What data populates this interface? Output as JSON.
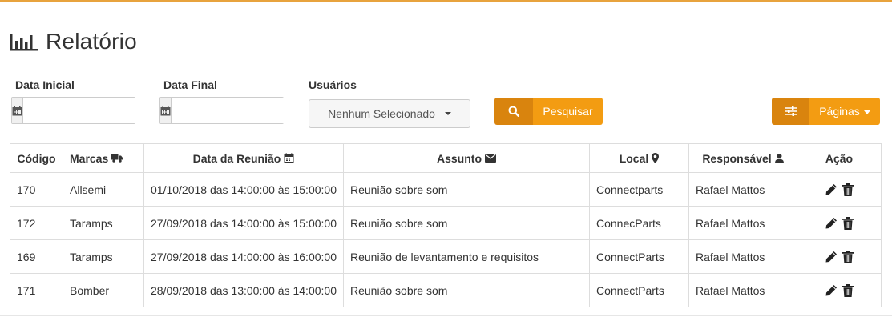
{
  "page": {
    "title": "Relatório",
    "title_icon": "bar-chart-icon"
  },
  "filters": {
    "data_inicial": {
      "label": "Data Inicial",
      "value": "",
      "icon": "calendar-icon"
    },
    "data_final": {
      "label": "Data Final",
      "value": "",
      "icon": "calendar-icon"
    },
    "usuarios": {
      "label": "Usuários",
      "selected": "Nenhum Selecionado"
    },
    "search_button": {
      "label": "Pesquisar",
      "icon": "search-icon"
    },
    "pages_button": {
      "label": "Páginas",
      "icon": "sliders-icon"
    }
  },
  "colors": {
    "accent": "#f39c12",
    "accent_dark": "#d9840e",
    "top_border": "#e8a33d"
  },
  "table": {
    "headers": {
      "codigo": "Código",
      "marcas": "Marcas",
      "data": "Data da Reunião",
      "assunto": "Assunto",
      "local": "Local",
      "responsavel": "Responsável",
      "acao": "Ação"
    },
    "header_icons": {
      "marcas": "truck-icon",
      "data": "calendar-icon",
      "assunto": "envelope-icon",
      "local": "map-marker-icon",
      "responsavel": "user-icon"
    },
    "rows": [
      {
        "codigo": "170",
        "marca": "Allsemi",
        "data": "01/10/2018 das 14:00:00 às 15:00:00",
        "assunto": "Reunião sobre som",
        "local": "Connectparts",
        "responsavel": "Rafael Mattos"
      },
      {
        "codigo": "172",
        "marca": "Taramps",
        "data": "27/09/2018 das 14:00:00 às 15:00:00",
        "assunto": "Reunião sobre som",
        "local": "ConnecParts",
        "responsavel": "Rafael Mattos"
      },
      {
        "codigo": "169",
        "marca": "Taramps",
        "data": "27/09/2018 das 14:00:00 às 16:00:00",
        "assunto": "Reunião de levantamento e requisitos",
        "local": "ConnectParts",
        "responsavel": "Rafael Mattos"
      },
      {
        "codigo": "171",
        "marca": "Bomber",
        "data": "28/09/2018 das 13:00:00 às 14:00:00",
        "assunto": "Reunião sobre som",
        "local": "ConnectParts",
        "responsavel": "Rafael Mattos"
      }
    ]
  }
}
